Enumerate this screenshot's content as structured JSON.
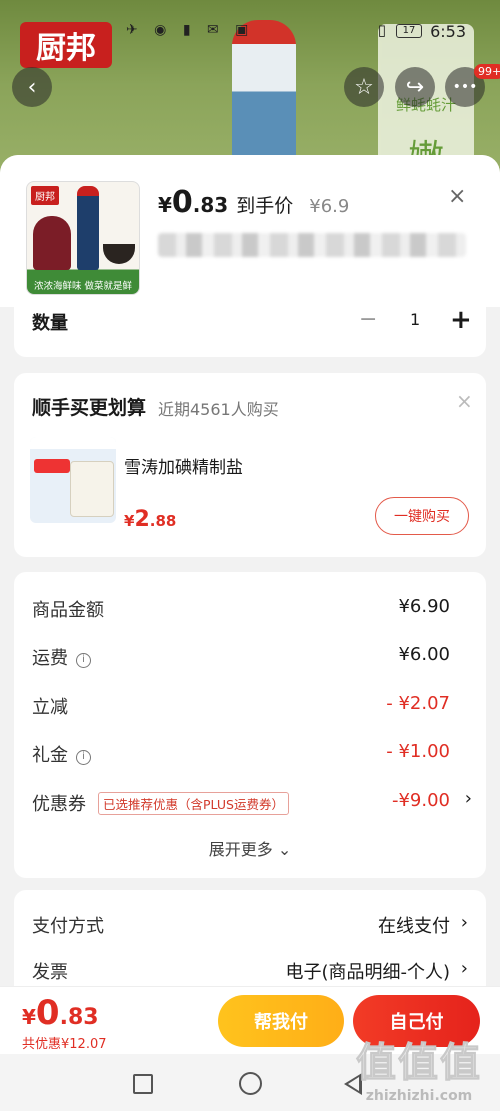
{
  "status": {
    "time": "6:53",
    "battery": "17",
    "icons": "✈ ◉ ▮ ✉ ▣"
  },
  "background": {
    "brand": "厨邦",
    "panel_text": "鲜蚝蚝汁",
    "panel_big": "嫩"
  },
  "top_actions": {
    "back": "‹",
    "favorite": "☆",
    "share": "↪",
    "more": "•••",
    "badge": "99+"
  },
  "product": {
    "price_symbol": "¥",
    "price_int": "0",
    "price_dec": ".83",
    "price_label": "到手价",
    "original_price": "¥6.9",
    "thumb_logo": "厨邦",
    "thumb_caption": "浓浓海鲜味 做菜就是鲜",
    "close": "×"
  },
  "quantity": {
    "label": "数量",
    "minus": "−",
    "value": "1",
    "plus": "+"
  },
  "bundle": {
    "title": "顺手买更划算",
    "subtitle": "近期4561人购买",
    "close": "×",
    "item_name": "雪涛加碘精制盐",
    "price_symbol": "¥",
    "price_int": "2",
    "price_dec": ".88",
    "buy_label": "一键购买"
  },
  "fees": {
    "rows": [
      {
        "label": "商品金额",
        "value": "¥6.90"
      },
      {
        "label": "运费",
        "value": "¥6.00"
      },
      {
        "label": "立减",
        "value": "- ¥2.07"
      },
      {
        "label": "礼金",
        "value": "- ¥1.00"
      },
      {
        "label": "优惠券",
        "value": "-¥9.00"
      }
    ],
    "info_icon": "i",
    "coupon_tag": "已选推荐优惠（含PLUS运费券）",
    "chevron": "›",
    "expand": "展开更多 ⌄"
  },
  "payment": {
    "method_label": "支付方式",
    "method_value": "在线支付",
    "invoice_label": "发票",
    "invoice_value": "电子(商品明细-个人)",
    "chevron": "›"
  },
  "bottom": {
    "total_symbol": "¥",
    "total_int": "0",
    "total_dec": ".83",
    "saving": "共优惠¥12.07",
    "help_pay": "帮我付",
    "self_pay": "自己付"
  },
  "watermark": {
    "big": "值值值",
    "small": "zhizhizhi.com"
  },
  "colors": {
    "accent": "#e02e24",
    "help_button": "#ffb81b",
    "text": "#1a1a1a"
  }
}
